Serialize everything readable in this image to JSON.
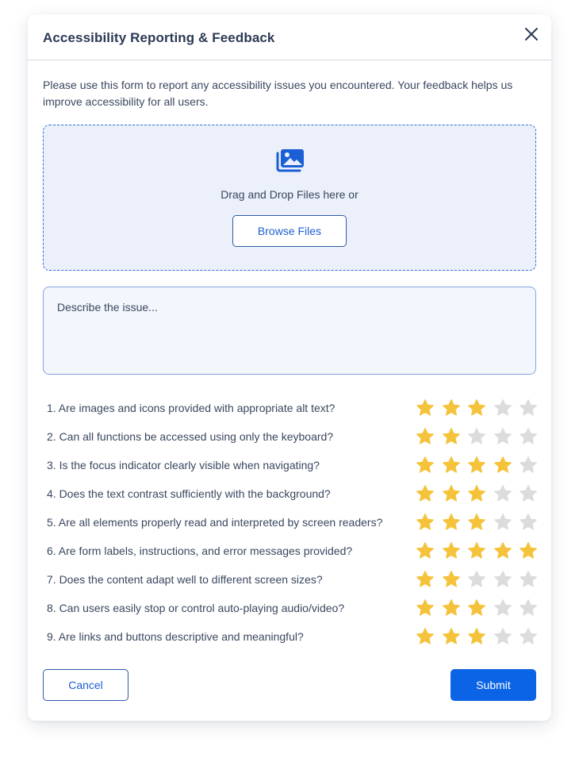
{
  "dialog": {
    "title": "Accessibility Reporting & Feedback",
    "intro": "Please use this form to report any accessibility issues you encountered. Your feedback helps us improve accessibility for all users."
  },
  "upload": {
    "icon": "image-gallery-icon",
    "prompt": "Drag and Drop Files here or",
    "browse_label": "Browse Files"
  },
  "issue": {
    "placeholder": "Describe the issue...",
    "value": ""
  },
  "rating_max": 5,
  "colors": {
    "star_filled": "#F5C33B",
    "star_empty": "#DCDCDC",
    "accent": "#0B63E5"
  },
  "questions": [
    {
      "text": "1. Are images and icons provided with appropriate alt text?",
      "rating": 3
    },
    {
      "text": "2. Can all functions be accessed using only the keyboard?",
      "rating": 2
    },
    {
      "text": "3. Is the focus indicator clearly visible when navigating?",
      "rating": 4
    },
    {
      "text": "4. Does the text contrast sufficiently with the background?",
      "rating": 3
    },
    {
      "text": "5. Are all elements properly read and interpreted by screen readers?",
      "rating": 3
    },
    {
      "text": "6. Are form labels, instructions, and error messages provided?",
      "rating": 5
    },
    {
      "text": "7. Does the content adapt well to different screen sizes?",
      "rating": 2
    },
    {
      "text": "8. Can users easily stop or control auto-playing audio/video?",
      "rating": 3
    },
    {
      "text": "9. Are links and buttons descriptive and meaningful?",
      "rating": 3
    }
  ],
  "footer": {
    "cancel_label": "Cancel",
    "submit_label": "Submit"
  }
}
